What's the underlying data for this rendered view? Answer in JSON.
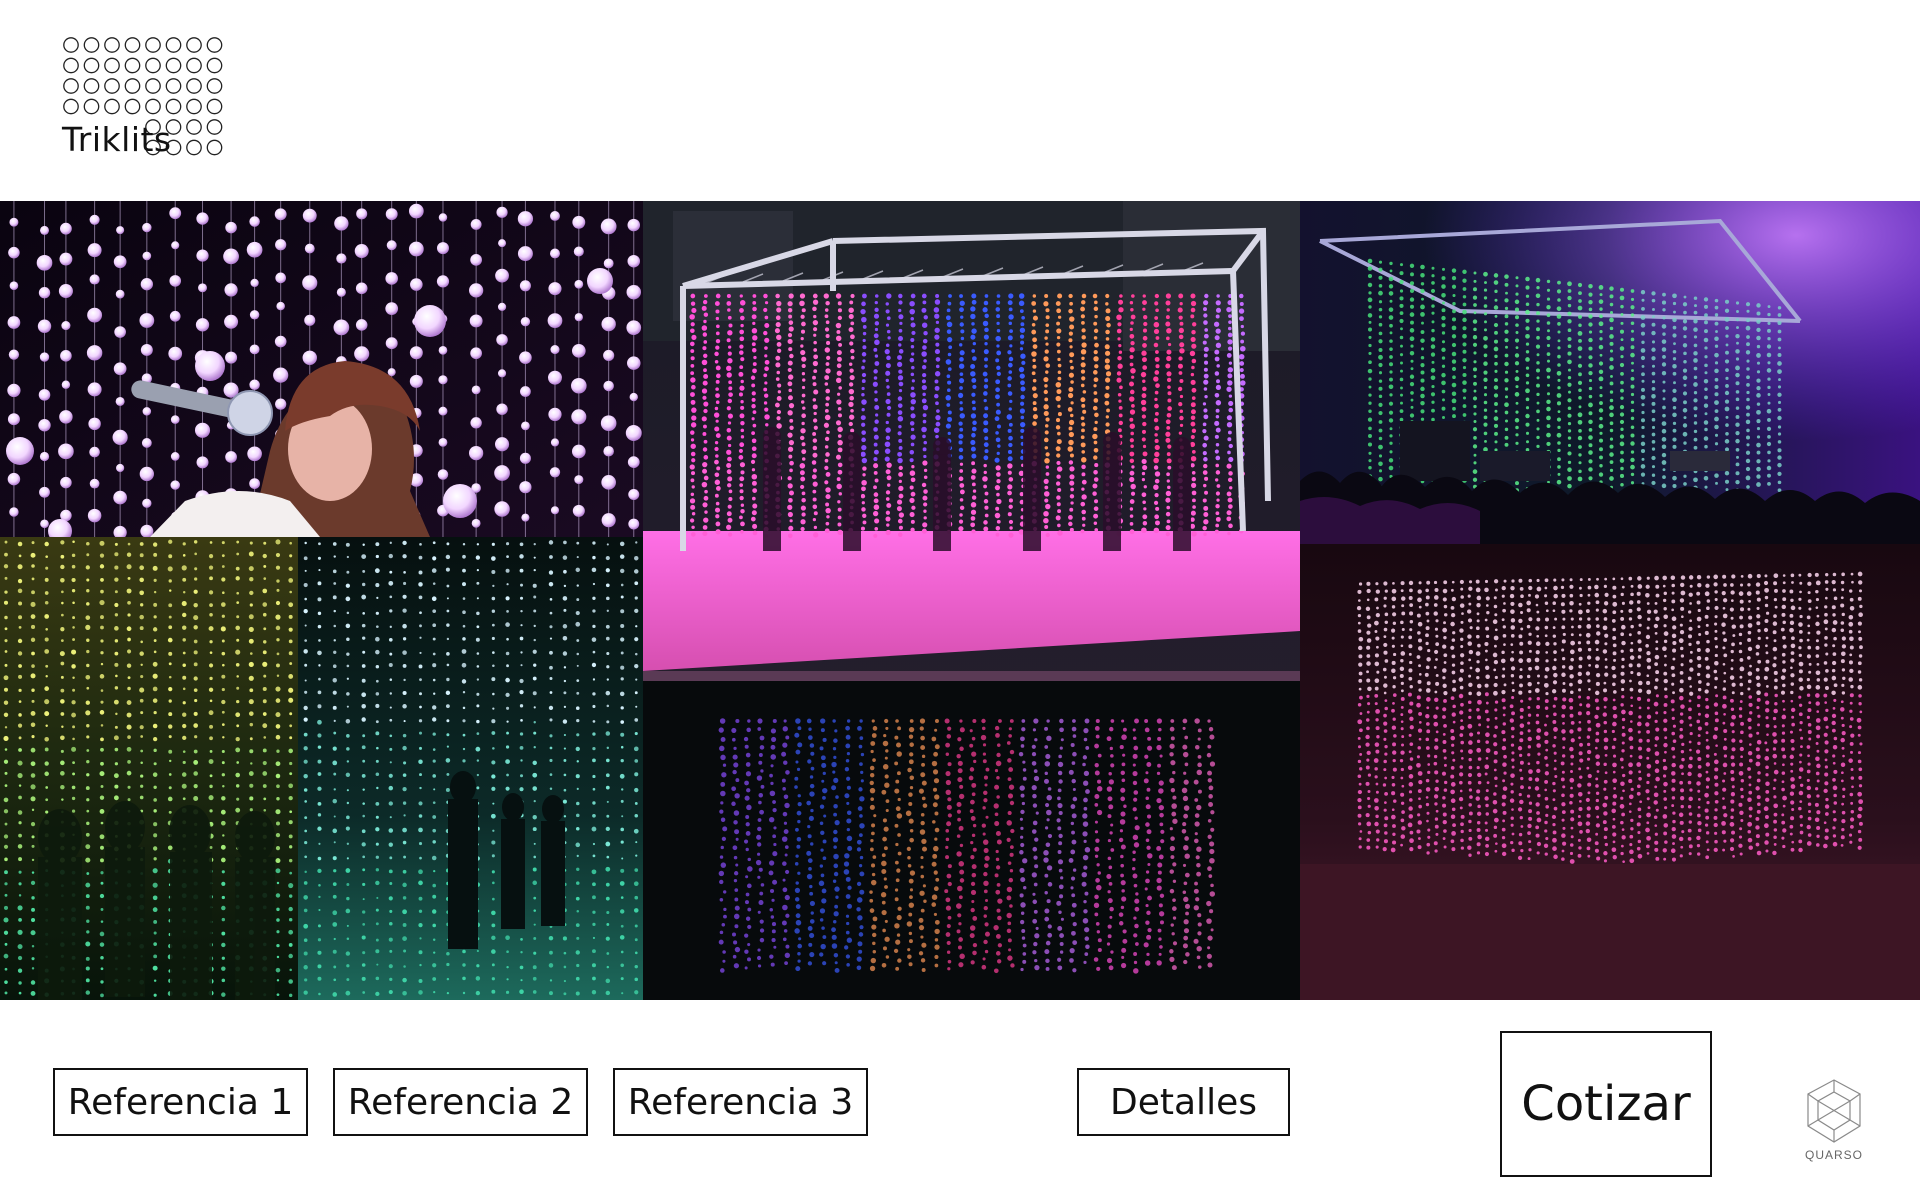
{
  "logo": {
    "word": "Triklits",
    "icon": "dot-grid-logo"
  },
  "gallery": {
    "photos": [
      {
        "name": "photo-singer-with-light-strands"
      },
      {
        "name": "photo-yellow-green-light-cube"
      },
      {
        "name": "photo-teal-light-cube-interior"
      },
      {
        "name": "photo-outdoor-truss-light-cube-reflection"
      },
      {
        "name": "photo-concert-stage-light-strands"
      },
      {
        "name": "photo-pink-light-cube"
      }
    ]
  },
  "buttons": {
    "ref1": "Referencia 1",
    "ref2": "Referencia 2",
    "ref3": "Referencia 3",
    "details": "Detalles",
    "quote": "Cotizar"
  },
  "brand": {
    "label": "QUARSO",
    "icon": "polyhedron-icon"
  },
  "colors": {
    "magenta": "#ff3fd0",
    "violet": "#8a4dff",
    "blue": "#3a5bff",
    "green": "#46e07a",
    "yellow": "#e8f06a",
    "teal": "#3fd6b8",
    "pink": "#ff5cc8"
  }
}
